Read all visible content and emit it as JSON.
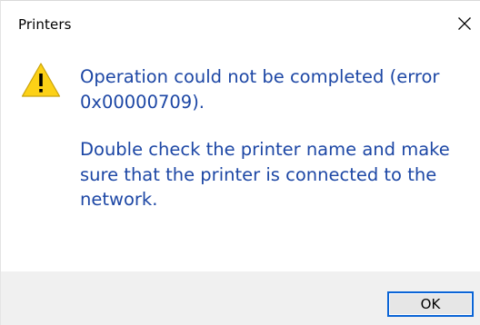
{
  "window": {
    "title": "Printers",
    "close_icon": "close-icon"
  },
  "content": {
    "icon": "warning-icon",
    "message_line1": "Operation could not be completed (error 0x00000709).",
    "message_line2": "Double check the printer name and make sure that the printer is connected to the network."
  },
  "footer": {
    "ok_label": "OK"
  },
  "colors": {
    "message_text": "#1d47a5",
    "warning_fill": "#fcd116",
    "footer_bg": "#f0f0f0",
    "focus_border": "#0a64d6"
  }
}
